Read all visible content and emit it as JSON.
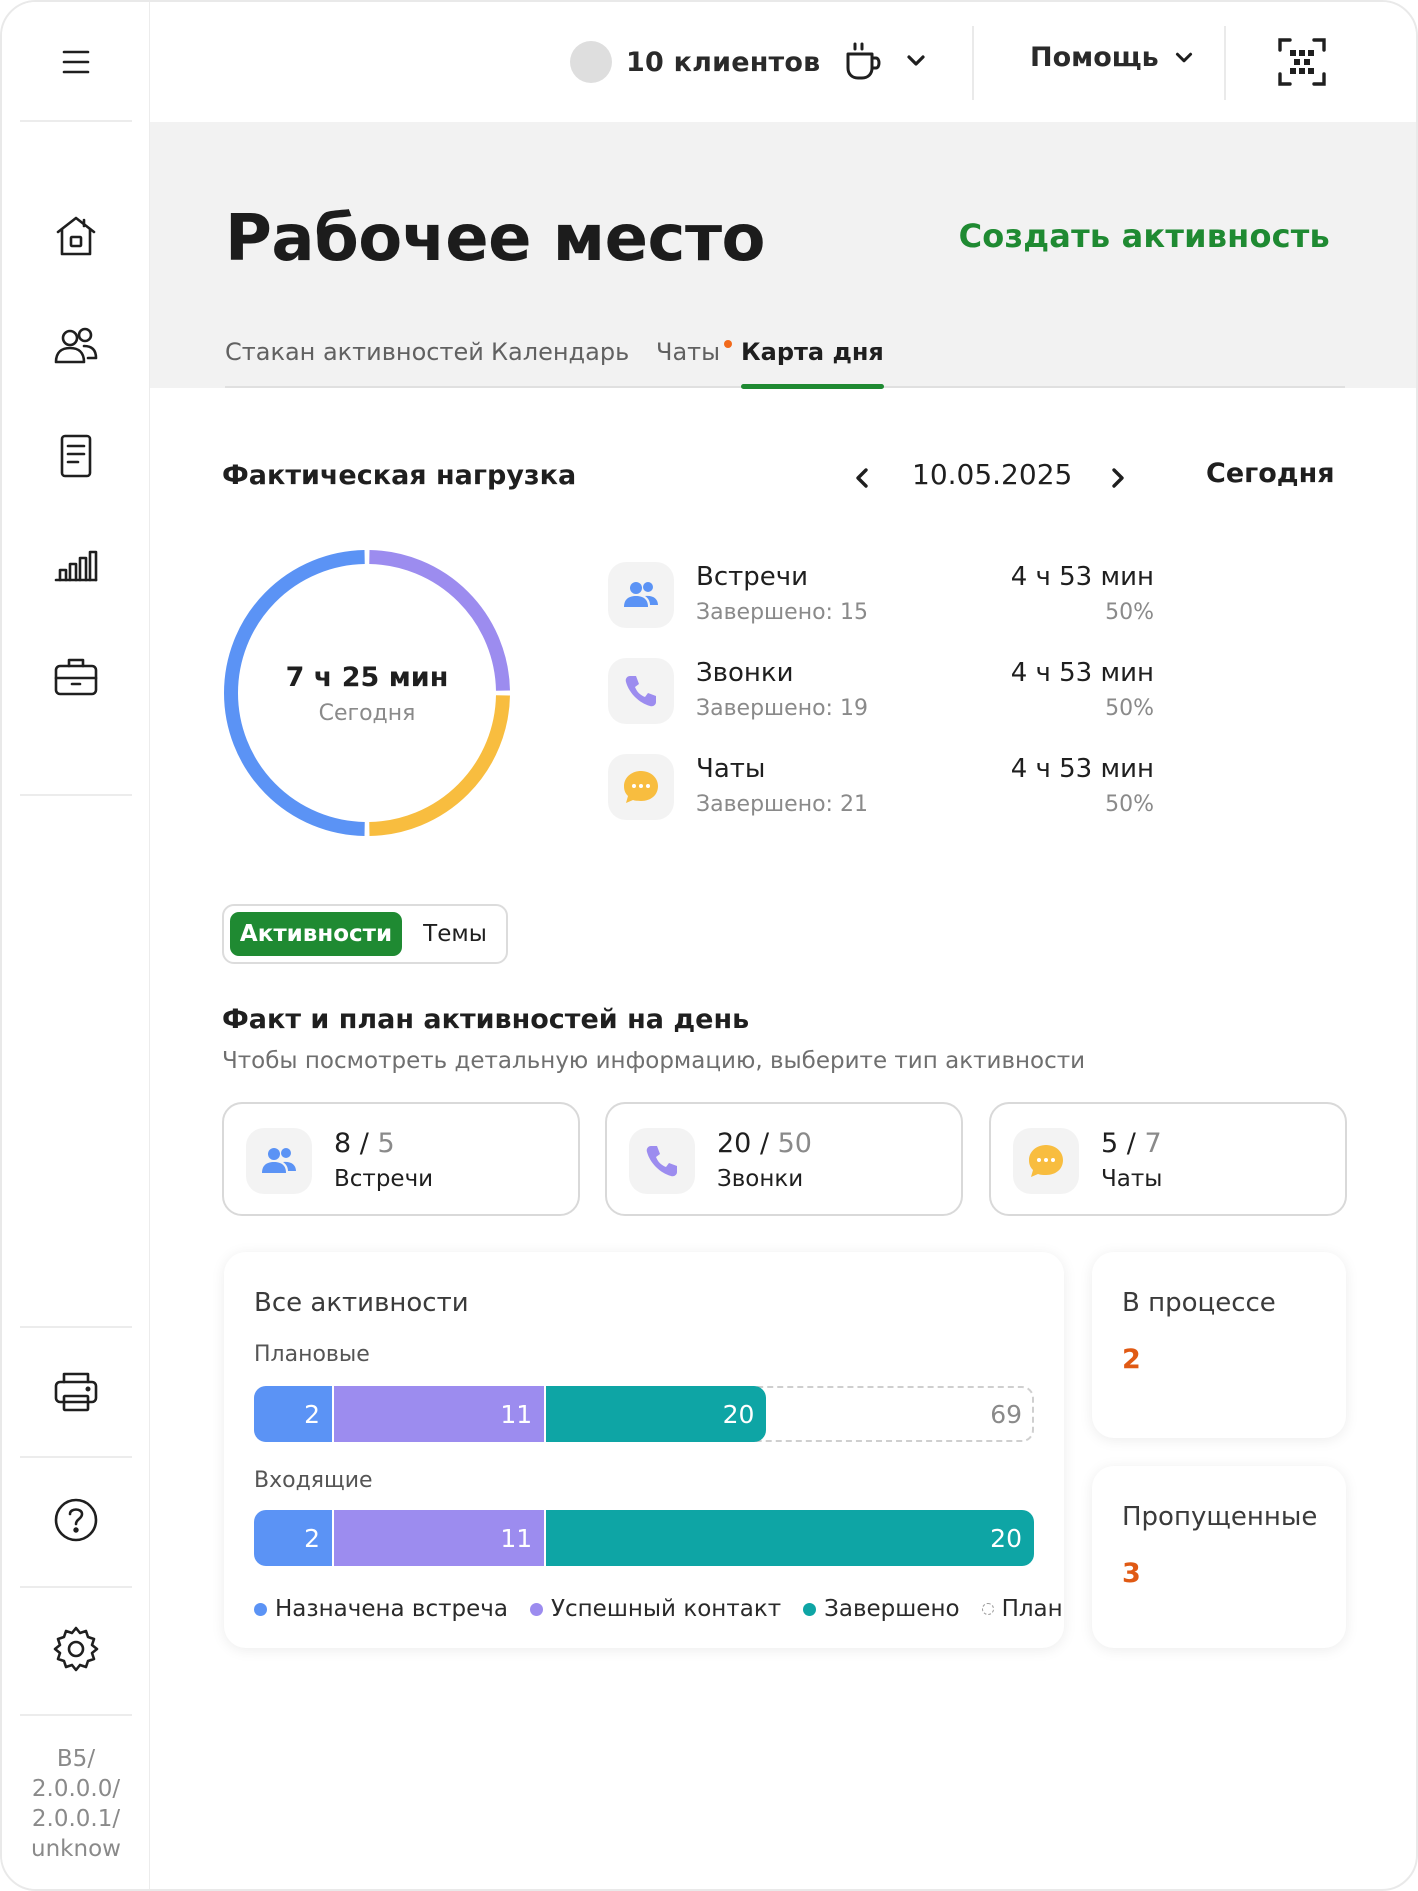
{
  "sidebar": {
    "menu_icon": "hamburger-icon",
    "nav": [
      "home-icon",
      "clients-icon",
      "documents-icon",
      "analytics-icon",
      "briefcase-icon"
    ],
    "bottom": [
      "printer-icon",
      "help-icon",
      "settings-icon"
    ],
    "version": [
      "B5/",
      "2.0.0.0/",
      "2.0.0.1/",
      "unknow"
    ]
  },
  "topbar": {
    "clients_label": "10 клиентов",
    "help_label": "Помощь"
  },
  "header": {
    "title": "Рабочее место",
    "create_action": "Создать активность",
    "tabs": [
      {
        "label": "Стакан активностей"
      },
      {
        "label": "Календарь"
      },
      {
        "label": "Чаты"
      },
      {
        "label": "Карта дня"
      }
    ],
    "active_tab": "Карта дня"
  },
  "load": {
    "title": "Фактическая нагрузка",
    "date": "10.05.2025",
    "today_button": "Сегодня",
    "total": "7 ч 25 мин",
    "total_caption": "Сегодня",
    "items": [
      {
        "name": "Встречи",
        "completed": "Завершено: 15",
        "duration": "4 ч 53 мин",
        "percent": "50%",
        "color": "#5b93f5"
      },
      {
        "name": "Звонки",
        "completed": "Завершено: 19",
        "duration": "4 ч 53 мин",
        "percent": "50%",
        "color": "#9c8cef"
      },
      {
        "name": "Чаты",
        "completed": "Завершено: 21",
        "duration": "4 ч 53 мин",
        "percent": "50%",
        "color": "#f8bd3f"
      }
    ],
    "donut_fractions": [
      0.5,
      0.25,
      0.25
    ]
  },
  "toggle": {
    "active": "Активности",
    "inactive": "Темы"
  },
  "factplan": {
    "title": "Факт и план активностей на день",
    "subtitle": "Чтобы посмотреть детальную информацию, выберите тип активности",
    "cards": [
      {
        "fact": "8",
        "plan": "5",
        "label": "Встречи"
      },
      {
        "fact": "20",
        "plan": "50",
        "label": "Звонки"
      },
      {
        "fact": "5",
        "plan": "7",
        "label": "Чаты"
      }
    ]
  },
  "all_activities": {
    "title": "Все активности",
    "rows": [
      {
        "label": "Плановые",
        "values": [
          2,
          11,
          20
        ],
        "plan": 69
      },
      {
        "label": "Входящие",
        "values": [
          2,
          11,
          20
        ],
        "plan": null
      }
    ],
    "legend": [
      "Назначена встреча",
      "Успешный контакт",
      "Завершено",
      "План"
    ],
    "colors": {
      "meeting": "#5b93f5",
      "contact": "#9c8cef",
      "done": "#0ea5a5"
    }
  },
  "in_progress": {
    "title": "В процессе",
    "value": "2"
  },
  "missed": {
    "title": "Пропущенные",
    "value": "3"
  },
  "colors": {
    "accent": "#1f8a32",
    "alert": "#e05a14",
    "tab_dot": "#f26a1b"
  }
}
